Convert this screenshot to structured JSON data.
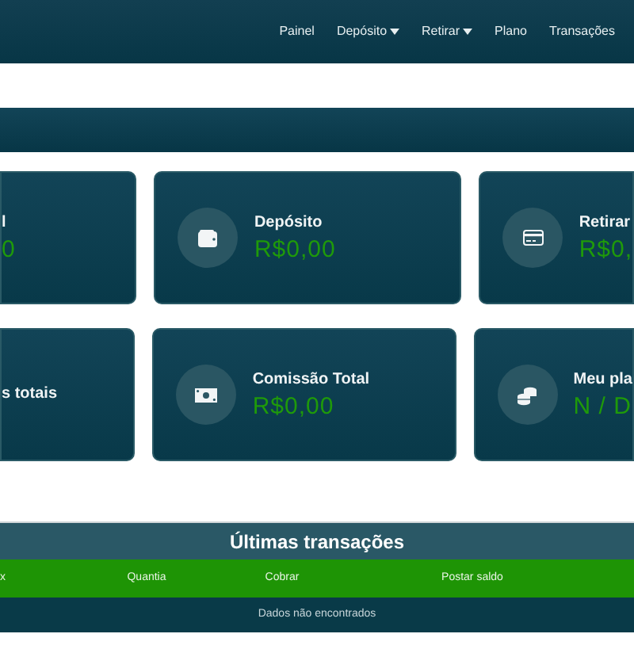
{
  "nav": {
    "items": [
      {
        "label": "Painel",
        "dropdown": false
      },
      {
        "label": "Depósito",
        "dropdown": true
      },
      {
        "label": "Retirar",
        "dropdown": true
      },
      {
        "label": "Plano",
        "dropdown": false
      },
      {
        "label": "Transações",
        "dropdown": false
      }
    ]
  },
  "card_rows": [
    [
      {
        "title": "l",
        "value": "0"
      },
      {
        "title": "Depósito",
        "value": "R$0,00",
        "kind": "wallet"
      },
      {
        "title": "Retirar",
        "value": "R$0,",
        "kind": "card"
      }
    ],
    [
      {
        "title": "s totais"
      },
      {
        "title": "Comissão Total",
        "value": "R$0,00",
        "kind": "money"
      },
      {
        "title": "Meu pla",
        "value": "N / D",
        "kind": "coins"
      }
    ]
  ],
  "transactions": {
    "title": "Últimas transações",
    "columns": [
      "x",
      "Quantia",
      "Cobrar",
      "Postar saldo"
    ],
    "empty_message": "Dados não encontrados"
  }
}
